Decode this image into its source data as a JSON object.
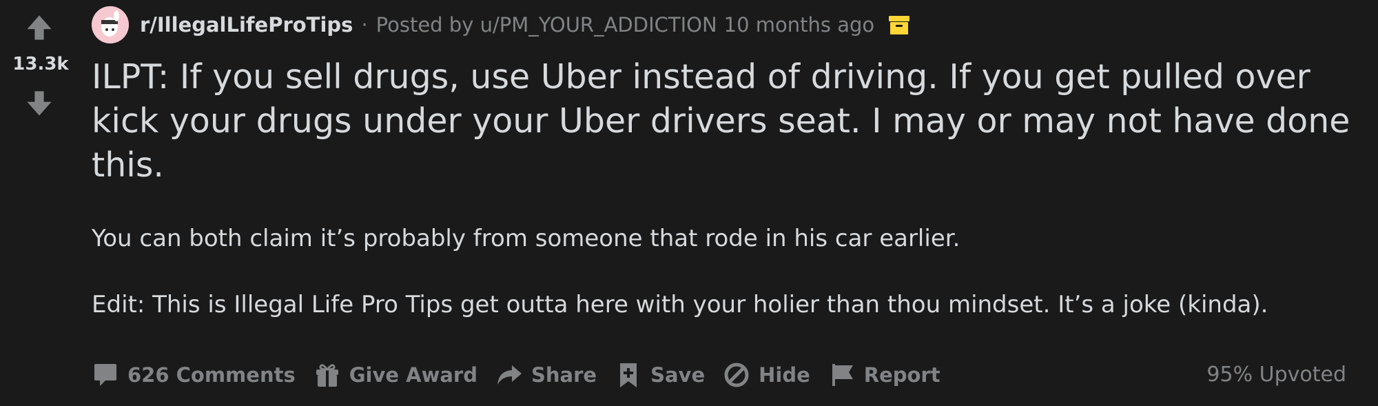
{
  "vote": {
    "score": "13.3k",
    "upvote_icon": "arrow-up-icon",
    "downvote_icon": "arrow-down-icon"
  },
  "post": {
    "subreddit": "r/IllegalLifeProTips",
    "separator": "·",
    "posted_by": "Posted by u/PM_YOUR_ADDICTION",
    "time_ago": "10 months ago",
    "archived_icon": "archive-icon",
    "title": "ILPT: If you sell drugs, use Uber instead of driving. If you get pulled over kick your drugs under your Uber drivers seat. I may or may not have done this.",
    "body": [
      "You can both claim it’s probably from someone that rode in his car earlier.",
      "Edit: This is Illegal Life Pro Tips get outta here with your holier than thou mindset. It’s a joke (kinda)."
    ]
  },
  "actions": {
    "comments": "626 Comments",
    "give_award": "Give Award",
    "share": "Share",
    "save": "Save",
    "hide": "Hide",
    "report": "Report"
  },
  "upvote_ratio": "95% Upvoted",
  "colors": {
    "background": "#1a1a1b",
    "text": "#d7dadc",
    "muted": "#818384",
    "archive": "#ffd635",
    "avatar_bg": "#f6c8cf"
  }
}
